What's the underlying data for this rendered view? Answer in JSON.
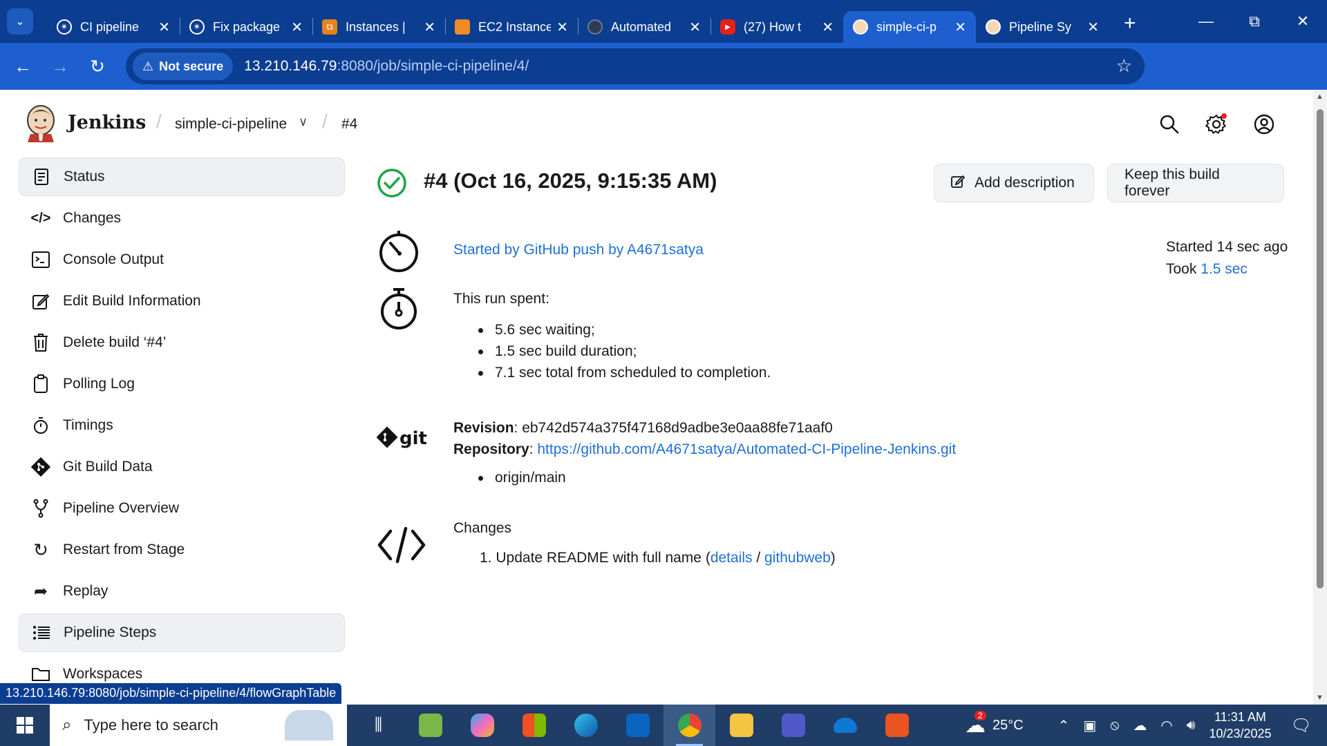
{
  "browser": {
    "tabs": [
      {
        "title": "CI pipeline",
        "icon": "chatgpt-icon",
        "active": false
      },
      {
        "title": "Fix package",
        "icon": "chatgpt-icon",
        "active": false
      },
      {
        "title": "Instances | ",
        "icon": "aws-icon",
        "active": false
      },
      {
        "title": "EC2 Instance",
        "icon": "aws-ec2-icon",
        "active": false
      },
      {
        "title": "Automated",
        "icon": "github-icon",
        "active": false
      },
      {
        "title": "(27) How t",
        "icon": "youtube-icon",
        "active": false
      },
      {
        "title": "simple-ci-p",
        "icon": "jenkins-icon",
        "active": true
      },
      {
        "title": "Pipeline Sy",
        "icon": "jenkins-icon",
        "active": false
      }
    ],
    "security_label": "Not secure",
    "url_host": "13.210.146.79",
    "url_rest": ":8080/job/simple-ci-pipeline/4/"
  },
  "header": {
    "app_name": "Jenkins",
    "breadcrumb_job": "simple-ci-pipeline",
    "breadcrumb_build": "#4"
  },
  "sidebar": {
    "items": [
      {
        "label": "Status",
        "icon": "status-icon",
        "active": true
      },
      {
        "label": "Changes",
        "icon": "code-icon",
        "active": false
      },
      {
        "label": "Console Output",
        "icon": "terminal-icon",
        "active": false
      },
      {
        "label": "Edit Build Information",
        "icon": "edit-icon",
        "active": false
      },
      {
        "label": "Delete build ‘#4’",
        "icon": "trash-icon",
        "active": false
      },
      {
        "label": "Polling Log",
        "icon": "clipboard-icon",
        "active": false
      },
      {
        "label": "Timings",
        "icon": "stopwatch-icon",
        "active": false
      },
      {
        "label": "Git Build Data",
        "icon": "git-icon",
        "active": false
      },
      {
        "label": "Pipeline Overview",
        "icon": "branch-icon",
        "active": false
      },
      {
        "label": "Restart from Stage",
        "icon": "restart-icon",
        "active": false
      },
      {
        "label": "Replay",
        "icon": "replay-icon",
        "active": false
      },
      {
        "label": "Pipeline Steps",
        "icon": "list-icon",
        "active": true
      },
      {
        "label": "Workspaces",
        "icon": "folder-icon",
        "active": false
      }
    ]
  },
  "build": {
    "title": "#4 (Oct 16, 2025, 9:15:35 AM)",
    "add_description_label": "Add description",
    "keep_forever_label": "Keep this build forever",
    "started_by": "Started by GitHub push by A4671satya",
    "started_ago": "Started 14 sec ago",
    "took_prefix": "Took",
    "took_value": "1.5 sec",
    "run_spent_label": "This run spent:",
    "run_spent_items": [
      "5.6 sec waiting;",
      "1.5 sec build duration;",
      "7.1 sec total from scheduled to completion."
    ],
    "revision_label": "Revision",
    "revision_value": "eb742d574a375f47168d9adbe3e0aa88fe71aaf0",
    "repository_label": "Repository",
    "repository_url": "https://github.com/A4671satya/Automated-CI-Pipeline-Jenkins.git",
    "branches": [
      "origin/main"
    ],
    "changes_label": "Changes",
    "change_number": "1.",
    "change_text": "Update README with full name (",
    "change_details": "details",
    "change_sep": " / ",
    "change_githubweb": "githubweb",
    "change_close": ")"
  },
  "status_tooltip": "13.210.146.79:8080/job/simple-ci-pipeline/4/flowGraphTable",
  "taskbar": {
    "search_placeholder": "Type here to search",
    "weather_temp": "25°C",
    "weather_badge": "2",
    "time": "11:31 AM",
    "date": "10/23/2025"
  },
  "colors": {
    "chrome_dark": "#0b3d91",
    "chrome_mid": "#1d5fcf",
    "link": "#1f6fd6",
    "success": "#1ea446"
  }
}
